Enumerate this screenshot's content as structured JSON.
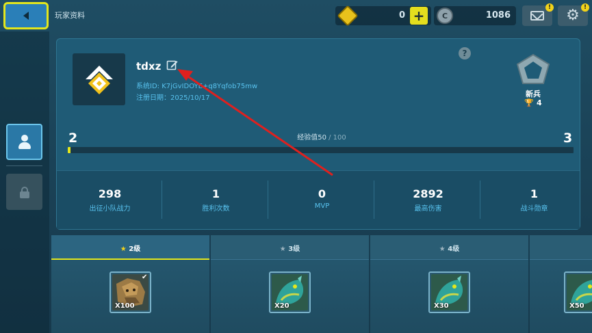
{
  "topbar": {
    "title": "玩家资料",
    "coins": "0",
    "gems": "1086",
    "plus_label": "+",
    "gem_symbol": "C",
    "mail_notify": "!",
    "settings_notify": "!",
    "gear_glyph": "⚙"
  },
  "profile": {
    "username": "tdxz",
    "system_id": "系统ID: K7jGvIDOYE+q8Yqfob75mw",
    "register_date": "注册日期：2025/10/17",
    "help": "?",
    "rank_name": "新兵",
    "trophy_icon": "🏆",
    "trophies": "4",
    "level_current": "2",
    "level_next": "3",
    "exp_label": "经验值",
    "exp_value": "50",
    "exp_max": " / 100",
    "exp_progress": 0.005
  },
  "stats": [
    {
      "value": "298",
      "label": "出征小队战力"
    },
    {
      "value": "1",
      "label": "胜利次数"
    },
    {
      "value": "0",
      "label": "MVP"
    },
    {
      "value": "2892",
      "label": "最高伤害"
    },
    {
      "value": "1",
      "label": "战斗勋章"
    }
  ],
  "tiers": [
    {
      "label": "2级",
      "qty": "X100",
      "item": "rock-golem"
    },
    {
      "label": "3级",
      "qty": "X20",
      "item": "green-dragon"
    },
    {
      "label": "4级",
      "qty": "X30",
      "item": "green-dragon"
    },
    {
      "label": "",
      "qty": "X50",
      "item": "green-dragon"
    }
  ],
  "colors": {
    "accent_yellow": "#e4e61c",
    "id_blue": "#58c2ee",
    "panel": "#1f5b76",
    "annotation_arrow": "#e0201e"
  }
}
